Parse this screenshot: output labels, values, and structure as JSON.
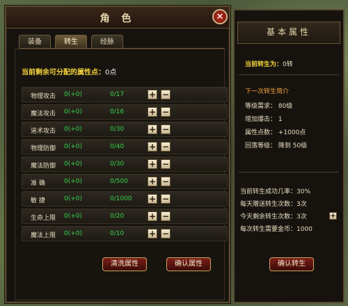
{
  "left_panel": {
    "title": "角  色",
    "close": "✕",
    "tabs": [
      "装备",
      "转生",
      "经脉"
    ],
    "active_tab": 1,
    "points_label": "当前剩余可分配的属性点：",
    "points_value": "0点",
    "plus": "+",
    "minus": "−",
    "rows": [
      {
        "name": "物理攻击",
        "base": "0(+0)",
        "ratio": "0/17"
      },
      {
        "name": "魔法攻击",
        "base": "0(+0)",
        "ratio": "0/16"
      },
      {
        "name": "道术攻击",
        "base": "0(+0)",
        "ratio": "0/30"
      },
      {
        "name": "物理防御",
        "base": "0(+0)",
        "ratio": "0/40"
      },
      {
        "name": "魔法防御",
        "base": "0(+0)",
        "ratio": "0/30"
      },
      {
        "name": "准    确",
        "base": "0(+0)",
        "ratio": "0/500"
      },
      {
        "name": "敏    捷",
        "base": "0(+0)",
        "ratio": "0/1000"
      },
      {
        "name": "生命上限",
        "base": "0(+0)",
        "ratio": "0/20"
      },
      {
        "name": "魔法上限",
        "base": "0(+0)",
        "ratio": "0/10"
      }
    ],
    "reset_button": "清洗属性",
    "confirm_button": "确认属性"
  },
  "right_panel": {
    "title": "基本属性",
    "rebirth_label": "当前转生为：",
    "rebirth_value": "0转",
    "next_title": "下一次转生简介",
    "level_req": "等级需求： 80级",
    "crit_add": "增加爆击： 1",
    "attr_points": "属性点数： +1000点",
    "fallback_level": "回落等级： 降到 50级",
    "success_rate": "当前转生成功几率：30%",
    "daily_gift": "每天赠送转生次数：3次",
    "remaining": "今天剩余转生次数：3次",
    "cost": "每次转生需要金币：1000",
    "plus": "+",
    "confirm_button": "确认转生"
  }
}
